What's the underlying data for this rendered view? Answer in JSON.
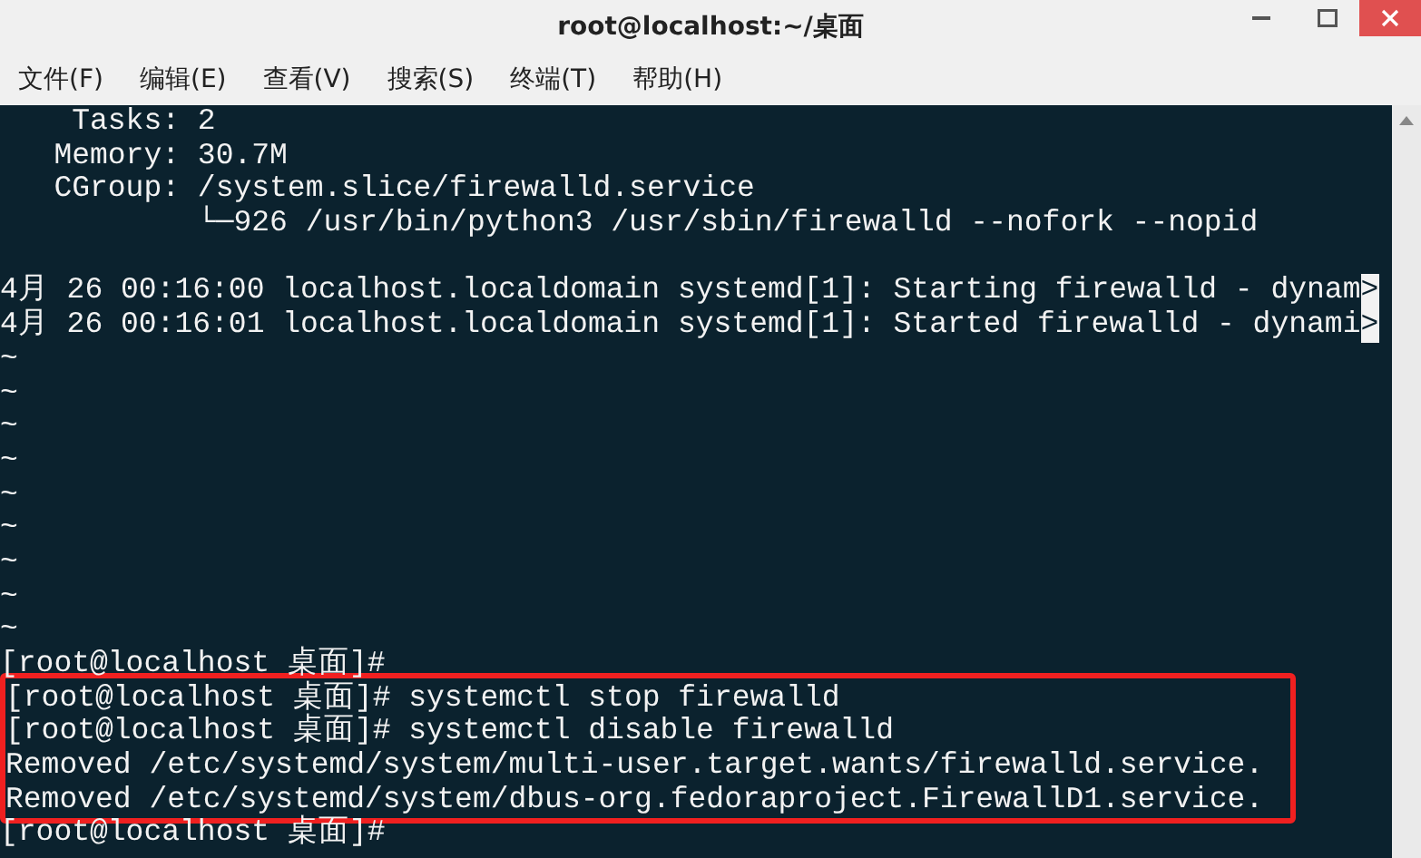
{
  "window": {
    "title": "root@localhost:~/桌面"
  },
  "menu": [
    "文件(F)",
    "编辑(E)",
    "查看(V)",
    "搜索(S)",
    "终端(T)",
    "帮助(H)"
  ],
  "terminal": {
    "blocks": [
      {
        "kind": "plain",
        "lines": [
          {
            "kind": "text",
            "text": "    Tasks: 2"
          },
          {
            "kind": "text",
            "text": "   Memory: 30.7M"
          },
          {
            "kind": "text",
            "text": "   CGroup: /system.slice/firewalld.service"
          },
          {
            "kind": "text",
            "text": "           └─926 /usr/bin/python3 /usr/sbin/firewalld --nofork --nopid"
          },
          {
            "kind": "blank"
          },
          {
            "kind": "text",
            "text": "4月 26 00:16:00 localhost.localdomain systemd[1]: Starting firewalld - dynam",
            "cut_marker": ">"
          },
          {
            "kind": "text",
            "text": "4月 26 00:16:01 localhost.localdomain systemd[1]: Started firewalld - dynami",
            "cut_marker": ">"
          },
          {
            "kind": "text",
            "text": "~"
          },
          {
            "kind": "text",
            "text": "~"
          },
          {
            "kind": "text",
            "text": "~"
          },
          {
            "kind": "text",
            "text": "~"
          },
          {
            "kind": "text",
            "text": "~"
          },
          {
            "kind": "text",
            "text": "~"
          },
          {
            "kind": "text",
            "text": "~"
          },
          {
            "kind": "text",
            "text": "~"
          },
          {
            "kind": "text",
            "text": "~"
          },
          {
            "kind": "text",
            "text": "[root@localhost 桌面]#"
          }
        ]
      },
      {
        "kind": "highlighted",
        "lines": [
          {
            "kind": "text",
            "text": "[root@localhost 桌面]# systemctl stop firewalld"
          },
          {
            "kind": "text",
            "text": "[root@localhost 桌面]# systemctl disable firewalld"
          },
          {
            "kind": "text",
            "text": "Removed /etc/systemd/system/multi-user.target.wants/firewalld.service."
          },
          {
            "kind": "text",
            "text": "Removed /etc/systemd/system/dbus-org.fedoraproject.FirewallD1.service."
          }
        ]
      },
      {
        "kind": "plain",
        "lines": [
          {
            "kind": "text",
            "text": "[root@localhost 桌面]#"
          }
        ]
      }
    ]
  }
}
